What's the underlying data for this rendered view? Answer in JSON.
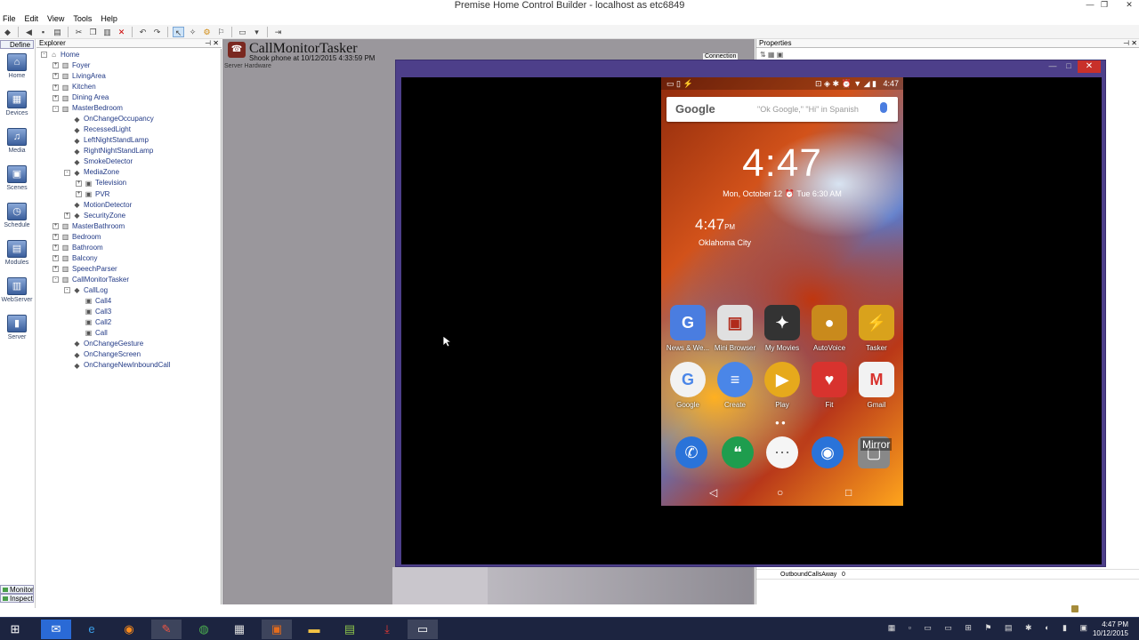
{
  "app": {
    "title": "Premise Home Control Builder - localhost as etc6849",
    "window_controls": {
      "minimize": "—",
      "maximize": "❐",
      "close": "✕"
    }
  },
  "menu": [
    "File",
    "Edit",
    "View",
    "Tools",
    "Help"
  ],
  "toolbar_icons": [
    "save-icon",
    "back-icon",
    "new-icon",
    "cut-icon",
    "copy-icon",
    "paste-icon",
    "delete-icon",
    "undo-icon",
    "redo-icon",
    "pointer-icon",
    "wand-icon",
    "gear-icon",
    "screen-icon"
  ],
  "leftnav": {
    "define_tab": "Define",
    "items": [
      "Home",
      "Devices",
      "Media",
      "Scenes",
      "Schedule",
      "Modules",
      "WebServer",
      "Server"
    ],
    "bottom_tabs": [
      "Monitor",
      "Inspect"
    ]
  },
  "explorer": {
    "header": "Explorer",
    "tree": [
      {
        "label": "Home",
        "level": 0,
        "exp": "-"
      },
      {
        "label": "Foyer",
        "level": 1,
        "exp": "+"
      },
      {
        "label": "LivingArea",
        "level": 1,
        "exp": "+"
      },
      {
        "label": "Kitchen",
        "level": 1,
        "exp": "+"
      },
      {
        "label": "Dining Area",
        "level": 1,
        "exp": "+"
      },
      {
        "label": "MasterBedroom",
        "level": 1,
        "exp": "-"
      },
      {
        "label": "OnChangeOccupancy",
        "level": 2,
        "exp": ""
      },
      {
        "label": "RecessedLight",
        "level": 2,
        "exp": ""
      },
      {
        "label": "LeftNightStandLamp",
        "level": 2,
        "exp": ""
      },
      {
        "label": "RightNightStandLamp",
        "level": 2,
        "exp": ""
      },
      {
        "label": "SmokeDetector",
        "level": 2,
        "exp": ""
      },
      {
        "label": "MediaZone",
        "level": 2,
        "exp": "-"
      },
      {
        "label": "Television",
        "level": 3,
        "exp": "+"
      },
      {
        "label": "PVR",
        "level": 3,
        "exp": "+"
      },
      {
        "label": "MotionDetector",
        "level": 2,
        "exp": ""
      },
      {
        "label": "SecurityZone",
        "level": 2,
        "exp": "+"
      },
      {
        "label": "MasterBathroom",
        "level": 1,
        "exp": "+"
      },
      {
        "label": "Bedroom",
        "level": 1,
        "exp": "+"
      },
      {
        "label": "Bathroom",
        "level": 1,
        "exp": "+"
      },
      {
        "label": "Balcony",
        "level": 1,
        "exp": "+"
      },
      {
        "label": "SpeechParser",
        "level": 1,
        "exp": "+"
      },
      {
        "label": "CallMonitorTasker",
        "level": 1,
        "exp": "-"
      },
      {
        "label": "CallLog",
        "level": 2,
        "exp": "-"
      },
      {
        "label": "Call4",
        "level": 3,
        "exp": ""
      },
      {
        "label": "Call3",
        "level": 3,
        "exp": ""
      },
      {
        "label": "Call2",
        "level": 3,
        "exp": ""
      },
      {
        "label": "Call",
        "level": 3,
        "exp": ""
      },
      {
        "label": "OnChangeGesture",
        "level": 2,
        "exp": ""
      },
      {
        "label": "OnChangeScreen",
        "level": 2,
        "exp": ""
      },
      {
        "label": "OnChangeNewInboundCall",
        "level": 2,
        "exp": ""
      }
    ]
  },
  "object": {
    "title": "CallMonitorTasker",
    "subtitle": "Shook phone at 10/12/2015 4:33:59 PM",
    "server_hardware": "Server Hardware",
    "connection": "Connection"
  },
  "properties": {
    "header": "Properties",
    "row_name": "OutboundCallsAway",
    "row_value": "0"
  },
  "phone": {
    "status_time": "4:47",
    "search_logo": "Google",
    "search_hint": "\"Ok Google,\" \"Hi\" in Spanish",
    "clock": "4:47",
    "date": "Mon, October 12",
    "alarm": "Tue 6:30 AM",
    "world_clock": "4:47",
    "world_clock_ampm": "PM",
    "world_city": "Oklahoma City",
    "apps_row1": [
      {
        "label": "News & We...",
        "icon": "news-icon",
        "color": "#4a7de0",
        "glyph": "G"
      },
      {
        "label": "Mini Browser",
        "icon": "gift-icon",
        "color": "#e0e0e0",
        "glyph": "▣"
      },
      {
        "label": "My Movies",
        "icon": "clapper-icon",
        "color": "#333333",
        "glyph": "✦"
      },
      {
        "label": "AutoVoice",
        "icon": "mic-icon",
        "color": "#c98a1c",
        "glyph": "●"
      },
      {
        "label": "Tasker",
        "icon": "bolt-icon",
        "color": "#d9a21c",
        "glyph": "⚡"
      }
    ],
    "apps_row2": [
      {
        "label": "Google",
        "icon": "google-icon",
        "color": "#f2f2f2",
        "glyph": "G"
      },
      {
        "label": "Create",
        "icon": "docs-icon",
        "color": "#4a86e8",
        "glyph": "≡"
      },
      {
        "label": "Play",
        "icon": "play-icon",
        "color": "#e6a91c",
        "glyph": "▶"
      },
      {
        "label": "Fit",
        "icon": "heart-icon",
        "color": "#d8332e",
        "glyph": "♥"
      },
      {
        "label": "Gmail",
        "icon": "gmail-icon",
        "color": "#f2f2f2",
        "glyph": "M"
      }
    ],
    "dock": [
      {
        "icon": "phone-icon",
        "color": "#2a73d9",
        "glyph": "✆"
      },
      {
        "icon": "hangouts-icon",
        "color": "#1e9d4e",
        "glyph": "❝"
      },
      {
        "icon": "apps-icon",
        "color": "#f5f5f5",
        "glyph": "⋯"
      },
      {
        "icon": "chrome-icon",
        "color": "#2a73d9",
        "glyph": "◉"
      },
      {
        "icon": "mirror-icon",
        "color": "#888888",
        "glyph": "▢"
      }
    ],
    "mirror_badge": "Mirror",
    "nav": {
      "back": "◁",
      "home": "○",
      "recents": "□"
    }
  },
  "taskbar": {
    "time": "4:47 PM",
    "date": "10/12/2015",
    "apps": [
      "windows-icon",
      "mail-icon",
      "ie-icon",
      "firefox-icon",
      "tool-icon",
      "chrome-icon",
      "apps-grid-icon",
      "slides-icon",
      "folder-icon",
      "notepad-icon",
      "pdf-icon",
      "window-icon"
    ]
  },
  "colors": {
    "mirror_frame": "#4d3f8a",
    "taskbar": "#1c2440",
    "tree_text": "#223a86"
  }
}
